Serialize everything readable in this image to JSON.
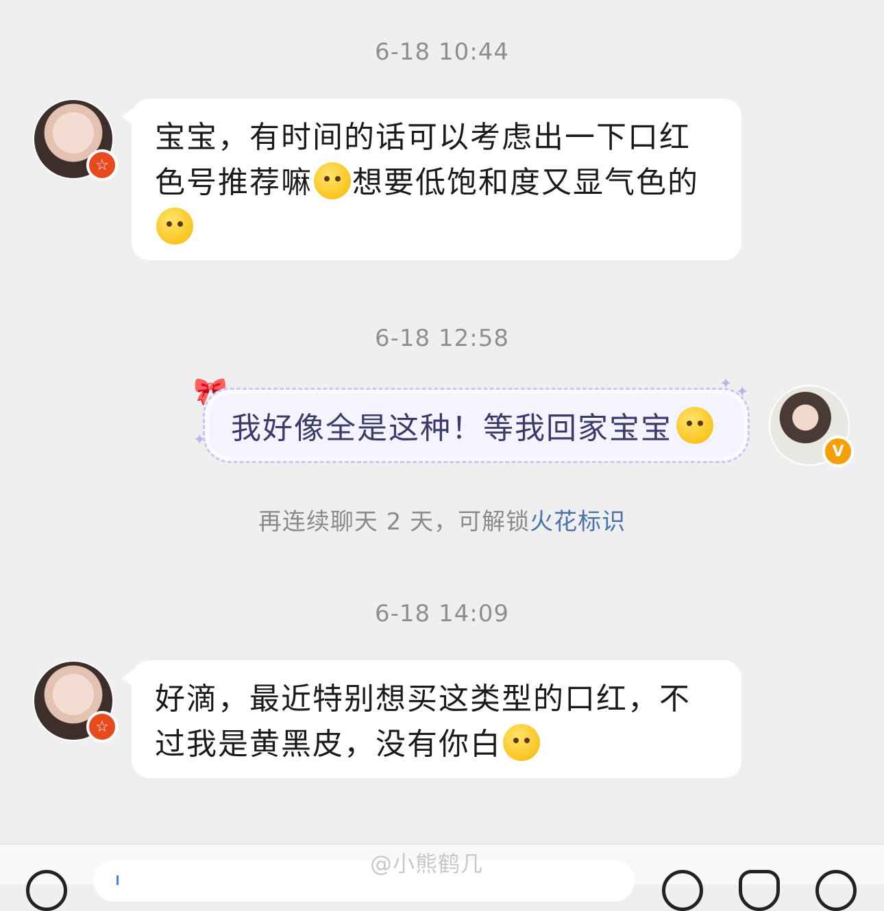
{
  "messages": [
    {
      "timestamp": "6-18 10:44",
      "line1": "宝宝，有时间的话可以考虑出一下口红",
      "line2a": "色号推荐嘛",
      "line2b": "想要低饱和度又显气色的"
    },
    {
      "timestamp": "6-18 12:58",
      "text": "我好像全是这种！等我回家宝宝"
    },
    {
      "timestamp": "6-18 14:09",
      "line1": "好滴，最近特别想买这类型的口红，不",
      "line2": "过我是黄黑皮，没有你白"
    }
  ],
  "streak_hint": {
    "text": "再连续聊天 2 天，可解锁",
    "link": "火花标识"
  },
  "watermark": "@小熊鹤几",
  "icons": {
    "emoji_kiss": "kiss-emoji-icon",
    "emoji_happy": "happy-blush-emoji-icon",
    "emoji_hug": "hug-emoji-icon",
    "voice": "voice-icon",
    "emoji_panel": "emoji-icon",
    "sticker": "sticker-icon",
    "add": "add-icon"
  },
  "colors": {
    "background": "#efefef",
    "bubble_in": "#ffffff",
    "bubble_out_border": "#c9c8f0",
    "link": "#4a72b0",
    "badge_red": "#e8491d",
    "badge_orange": "#f5a00a"
  }
}
